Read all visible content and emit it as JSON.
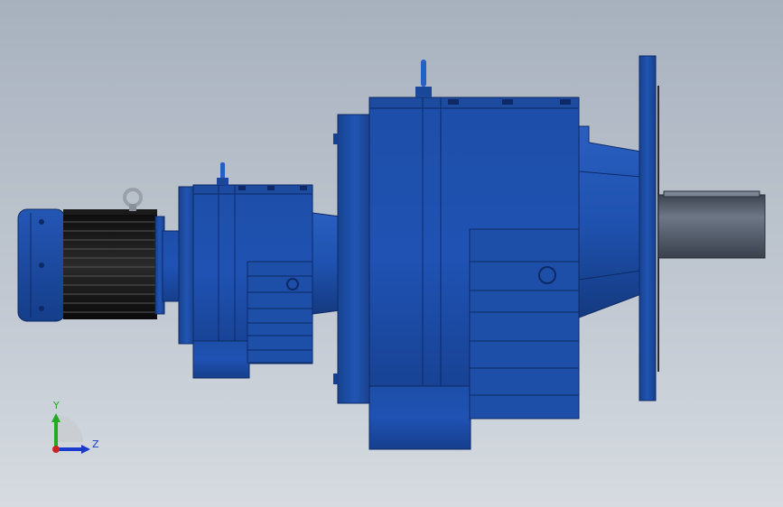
{
  "viewport": {
    "background_top": "#a7b1be",
    "background_bottom": "#d6dbe1",
    "model_color": "#1f4fa6",
    "shaft_color": "#5c6675",
    "motor_winding_color": "#111111"
  },
  "triad": {
    "y_label": "Y",
    "z_label": "Z",
    "y_color": "#22aa22",
    "z_color": "#1a3acc",
    "x_color": "#cc2222"
  }
}
